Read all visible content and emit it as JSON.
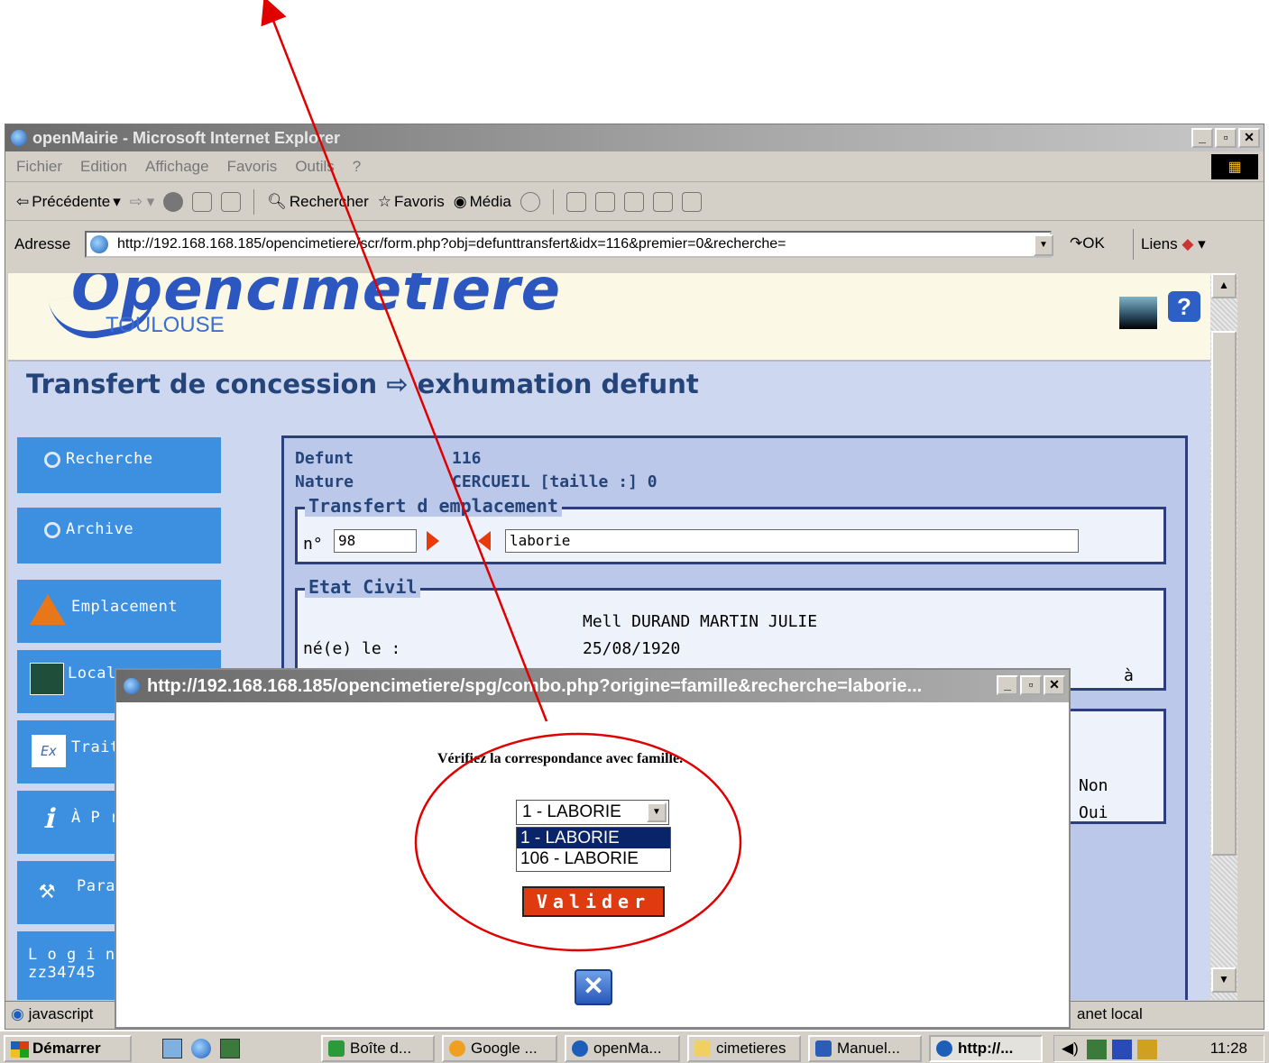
{
  "browser": {
    "title": "openMairie - Microsoft Internet Explorer",
    "menu": [
      "Fichier",
      "Edition",
      "Affichage",
      "Favoris",
      "Outils",
      "?"
    ],
    "toolbar": {
      "back": "Précédente",
      "search": "Rechercher",
      "favorites": "Favoris",
      "media": "Média"
    },
    "address_label": "Adresse",
    "url": "http://192.168.168.185/opencimetiere/scr/form.php?obj=defunttransfert&idx=116&premier=0&recherche=",
    "go_label": "OK",
    "links_label": "Liens",
    "status_left": "javascript",
    "status_right": "anet local"
  },
  "app": {
    "logo": "Opencimetiere",
    "city": "TOULOUSE",
    "help": "?",
    "title": "Transfert de concession ⇨ exhumation defunt"
  },
  "sidebar": {
    "items": [
      {
        "label": "Recherche"
      },
      {
        "label": "Archive"
      },
      {
        "label": "Emplacement"
      },
      {
        "label": "Local"
      },
      {
        "label": "Traite"
      },
      {
        "label": "À P r"
      },
      {
        "label": "Para"
      },
      {
        "label": "L o g i n"
      },
      {
        "label": "zz34745"
      }
    ]
  },
  "form": {
    "defunt_label": "Defunt",
    "defunt_value": "116",
    "nature_label": "Nature",
    "nature_value": "CERCUEIL [taille :] 0",
    "transfert_legend": "Transfert d emplacement",
    "no_label": "n°",
    "no_value": "98",
    "famille_value": "laborie",
    "etat_civil_legend": "Etat Civil",
    "nom": "Mell DURAND MARTIN JULIE",
    "ne_label": "né(e) le :",
    "ne_value": "25/08/1920",
    "a_label": "à",
    "non": "Non",
    "oui": "Oui"
  },
  "popup": {
    "title": "http://192.168.168.185/opencimetiere/spg/combo.php?origine=famille&recherche=laborie...",
    "message": "Vérifiez la correspondance avec famille.",
    "selected": "1 - LABORIE",
    "options": [
      "1 - LABORIE",
      "106 - LABORIE"
    ],
    "submit": "Valider",
    "close": "✕"
  },
  "taskbar": {
    "start": "Démarrer",
    "tasks": [
      "Boîte d...",
      "Google ...",
      "openMa...",
      "cimetieres",
      "Manuel...",
      "http://..."
    ],
    "clock": "11:28"
  },
  "colors": {
    "annotation": "#e00000",
    "button_red": "#e03a10",
    "sidebar_blue": "#3d8fe0",
    "title_blue": "#25457a"
  }
}
